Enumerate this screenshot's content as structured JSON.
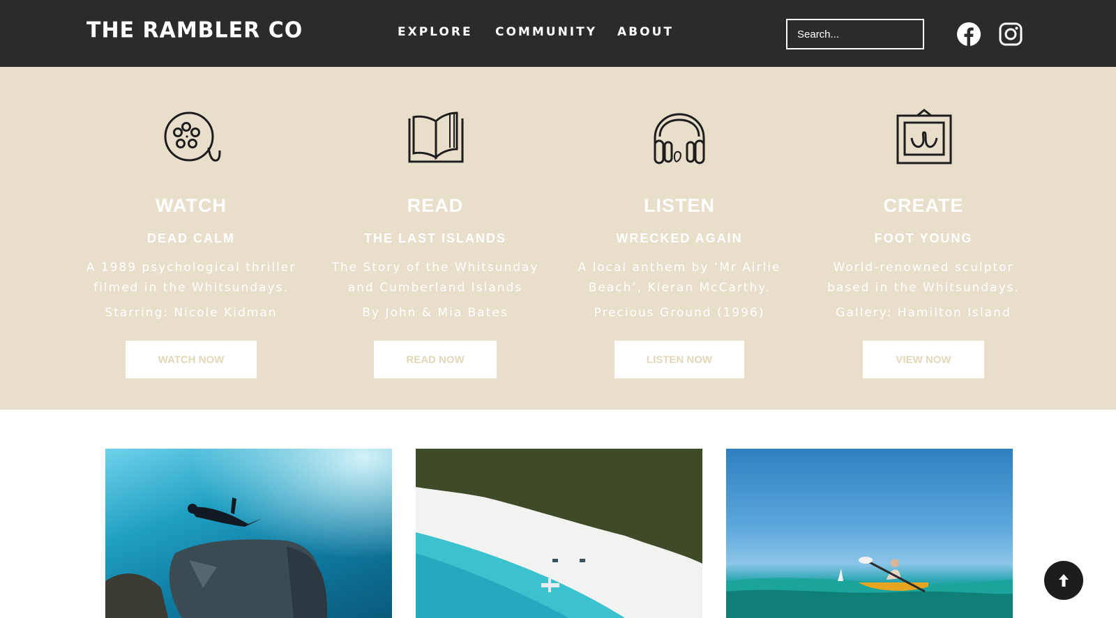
{
  "header": {
    "logo": "THE RAMBLER CO",
    "nav": {
      "explore": "EXPLORE",
      "community": "COMMUNITY",
      "about": "ABOUT"
    },
    "search_placeholder": "Search...",
    "social": [
      "facebook-icon",
      "instagram-icon"
    ]
  },
  "features": [
    {
      "icon": "film-reel-icon",
      "category": "WATCH",
      "title": "DEAD CALM",
      "description": "A 1989 psychological thriller filmed in the Whitsundays.",
      "extra": "Starring: Nicole Kidman",
      "button": "WATCH NOW"
    },
    {
      "icon": "open-book-icon",
      "category": "READ",
      "title": "THE LAST ISLANDS",
      "description": "The Story of the Whitsunday and Cumberland Islands",
      "extra": "By John & Mia Bates",
      "button": "READ NOW"
    },
    {
      "icon": "headphones-icon",
      "category": "LISTEN",
      "title": "WRECKED AGAIN",
      "description": "A local anthem by ‘Mr Airlie Beach’, Kieran McCarthy.",
      "extra": "Precious Ground (1996)",
      "button": "LISTEN NOW"
    },
    {
      "icon": "framed-art-icon",
      "category": "CREATE",
      "title": "FOOT YOUNG",
      "description": "World-renowned sculptor based in the Whitsundays.",
      "extra": "Gallery: Hamilton Island",
      "button": "VIEW NOW"
    }
  ],
  "colors": {
    "header_bg": "#2b2b2b",
    "band_bg": "#e8dfca",
    "button_text": "#e3d7b8"
  },
  "back_to_top_icon": "arrow-up-icon"
}
